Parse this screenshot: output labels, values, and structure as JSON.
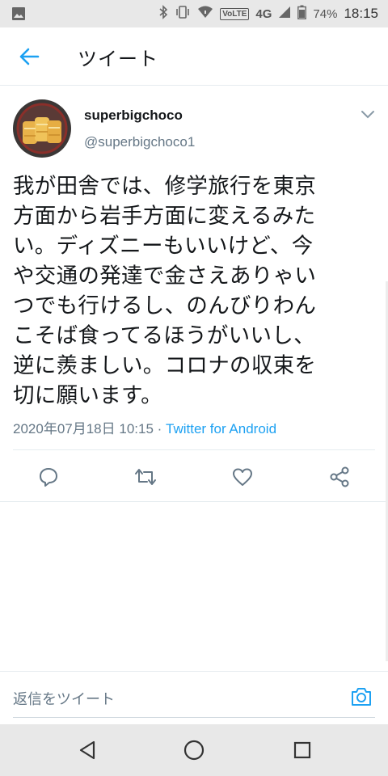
{
  "status_bar": {
    "network_label": "4G",
    "volte_label": "VoLTE",
    "battery": "74%",
    "time": "18:15"
  },
  "header": {
    "title": "ツイート"
  },
  "tweet": {
    "display_name": "superbigchoco",
    "handle": "@superbigchoco1",
    "text_lines": [
      "我が田舎では、修学旅行を東京",
      "方面から岩手方面に変えるみた",
      "い。ディズニーもいいけど、今",
      "や交通の発達で金さえありゃい",
      "つでも行けるし、のんびりわん",
      "こそば食ってるほうがいいし、",
      "逆に羨ましい。コロナの収束を",
      "切に願います。"
    ],
    "timestamp": "2020年07月18日 10:15",
    "separator": " · ",
    "source": "Twitter for Android"
  },
  "actions": [
    {
      "name": "reply-icon"
    },
    {
      "name": "retweet-icon"
    },
    {
      "name": "like-icon"
    },
    {
      "name": "share-icon"
    }
  ],
  "reply_bar": {
    "placeholder": "返信をツイート"
  },
  "colors": {
    "accent": "#1da1f2",
    "text": "#14171a",
    "muted": "#657786"
  }
}
